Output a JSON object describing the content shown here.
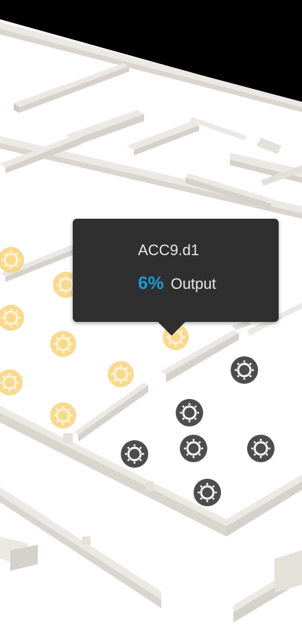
{
  "tooltip": {
    "title": "ACC9.d1",
    "value": "6%",
    "label": "Output"
  },
  "colors": {
    "accent_value": "#1a9bd1",
    "marker_active": "#f9d27a",
    "marker_inactive": "#4d4d4d",
    "floor": "#ffffff",
    "wall": "#e6e2dc",
    "background": "#000000",
    "tooltip_bg": "#2f2f30"
  },
  "markers": [
    {
      "id": "marker-1",
      "state": "active",
      "icon": "sensor-icon"
    },
    {
      "id": "marker-2",
      "state": "active",
      "icon": "sensor-icon"
    },
    {
      "id": "marker-3",
      "state": "active",
      "icon": "sensor-icon"
    },
    {
      "id": "marker-4",
      "state": "active",
      "icon": "sensor-icon"
    },
    {
      "id": "marker-5",
      "state": "active",
      "icon": "sensor-icon"
    },
    {
      "id": "marker-6",
      "state": "active",
      "icon": "sensor-icon"
    },
    {
      "id": "marker-7",
      "state": "active",
      "icon": "sensor-icon"
    },
    {
      "id": "marker-8",
      "state": "active",
      "icon": "sensor-icon"
    },
    {
      "id": "marker-9",
      "state": "active",
      "icon": "sensor-icon"
    },
    {
      "id": "marker-10",
      "state": "inactive",
      "icon": "sensor-icon"
    },
    {
      "id": "marker-11",
      "state": "inactive",
      "icon": "sensor-icon"
    },
    {
      "id": "marker-12",
      "state": "inactive",
      "icon": "sensor-icon"
    },
    {
      "id": "marker-13",
      "state": "inactive",
      "icon": "sensor-icon"
    },
    {
      "id": "marker-14",
      "state": "inactive",
      "icon": "sensor-icon"
    },
    {
      "id": "marker-15",
      "state": "inactive",
      "icon": "sensor-icon"
    }
  ]
}
